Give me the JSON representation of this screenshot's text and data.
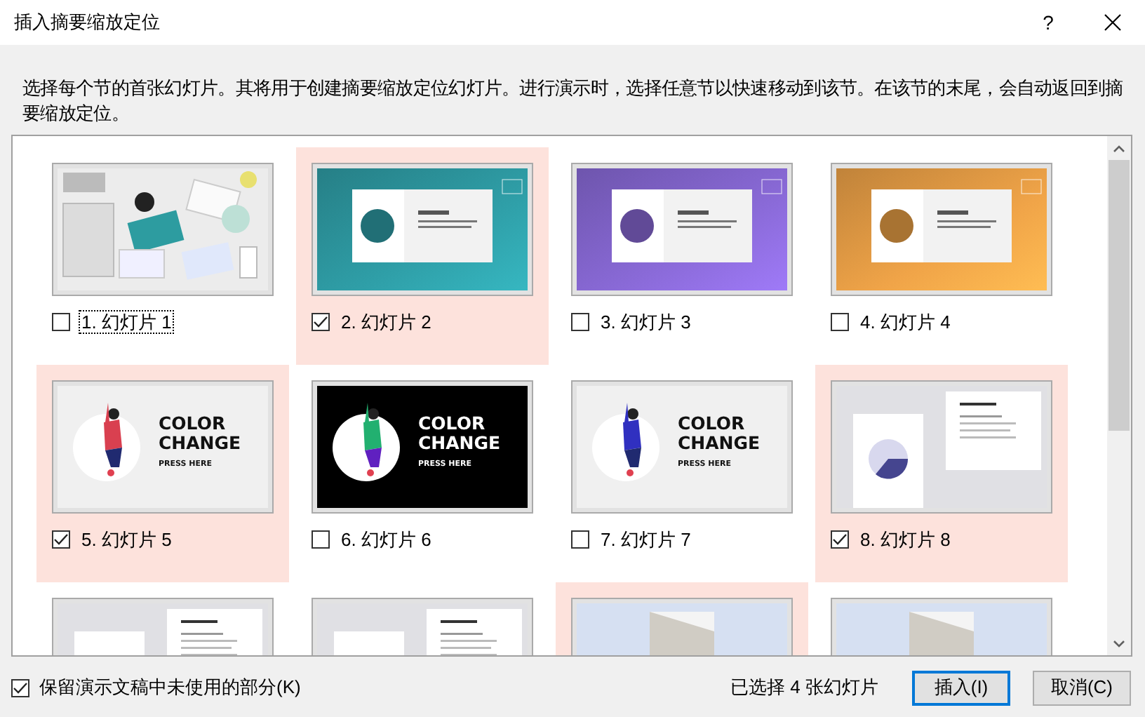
{
  "window": {
    "title": "插入摘要缩放定位",
    "help": "?"
  },
  "description": "选择每个节的首张幻灯片。其将用于创建摘要缩放定位幻灯片。进行演示时，选择任意节以快速移动到该节。在该节的末尾，会自动返回到摘要缩放定位。",
  "slides": [
    {
      "label": "1. 幻灯片 1",
      "checked": false,
      "focused": true
    },
    {
      "label": "2. 幻灯片 2",
      "checked": true,
      "focused": false,
      "thumbnail": {
        "kind": "gradient",
        "color": "#2f9fa8"
      }
    },
    {
      "label": "3. 幻灯片 3",
      "checked": false,
      "focused": false,
      "thumbnail": {
        "kind": "gradient",
        "color": "#8a6ad8"
      }
    },
    {
      "label": "4. 幻灯片 4",
      "checked": false,
      "focused": false,
      "thumbnail": {
        "kind": "gradient",
        "color": "#f0a448"
      }
    },
    {
      "label": "5. 幻灯片 5",
      "checked": true,
      "focused": false,
      "thumbnail": {
        "kind": "poster",
        "dark": false,
        "color": "#d94050",
        "title_lines": [
          "COLOR",
          "CHANGE"
        ],
        "subtitle": "PRESS HERE"
      }
    },
    {
      "label": "6. 幻灯片 6",
      "checked": false,
      "focused": false,
      "thumbnail": {
        "kind": "poster",
        "dark": true,
        "color": "#22b070",
        "title_lines": [
          "COLOR",
          "CHANGE"
        ],
        "subtitle": "PRESS HERE"
      }
    },
    {
      "label": "7. 幻灯片 7",
      "checked": false,
      "focused": false,
      "thumbnail": {
        "kind": "poster",
        "dark": false,
        "color": "#3030c0",
        "title_lines": [
          "COLOR",
          "CHANGE"
        ],
        "subtitle": "PRESS HERE"
      }
    },
    {
      "label": "8. 幻灯片 8",
      "checked": true,
      "focused": false,
      "thumbnail": {
        "kind": "dial"
      }
    },
    {
      "checked": false,
      "thumbnail": {
        "kind": "outline"
      }
    },
    {
      "checked": false,
      "thumbnail": {
        "kind": "outline"
      }
    },
    {
      "checked": true,
      "thumbnail": {
        "kind": "photo-card"
      }
    },
    {
      "checked": false,
      "thumbnail": {
        "kind": "photo-card"
      }
    }
  ],
  "keep_unused": {
    "label": "保留演示文稿中未使用的部分(K)",
    "checked": true
  },
  "status": "已选择 4 张幻灯片",
  "buttons": [
    {
      "label": "插入(I)",
      "default": true
    },
    {
      "label": "取消(C)",
      "default": false
    }
  ]
}
